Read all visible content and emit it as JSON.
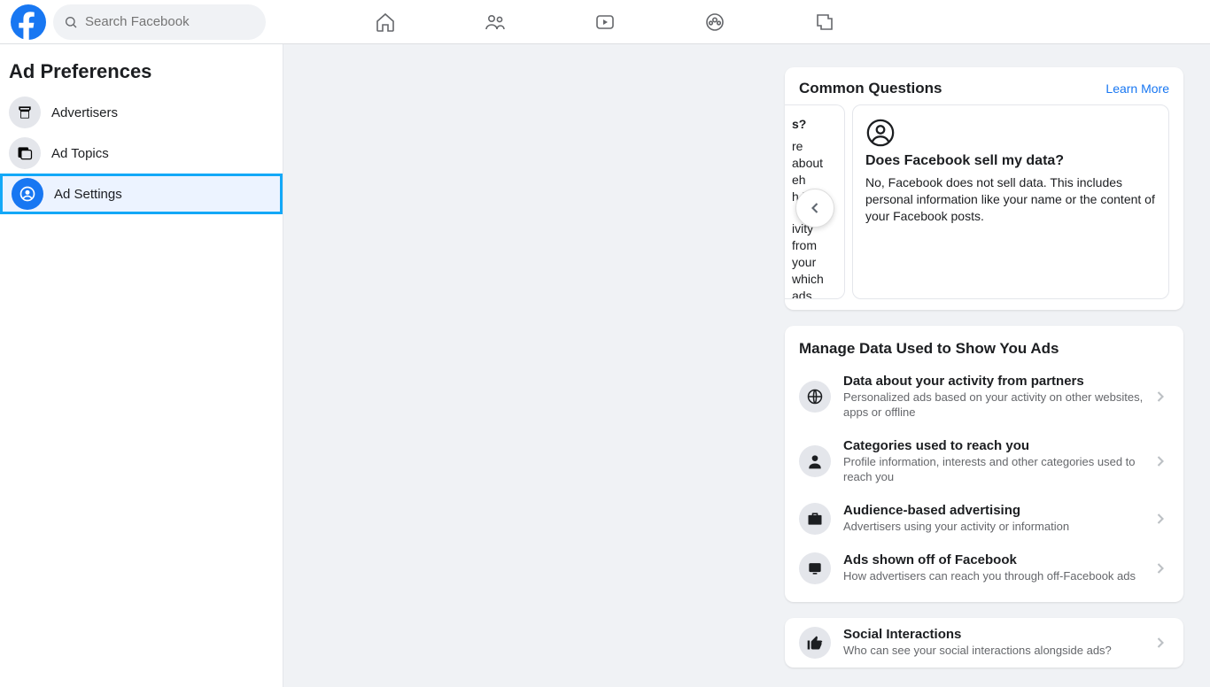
{
  "search": {
    "placeholder": "Search Facebook"
  },
  "sidebar": {
    "title": "Ad Preferences",
    "items": [
      {
        "label": "Advertisers"
      },
      {
        "label": "Ad Topics"
      },
      {
        "label": "Ad Settings"
      }
    ]
  },
  "commonQuestions": {
    "title": "Common Questions",
    "learnMore": "Learn More",
    "partial": {
      "titleFrag": "s?",
      "line1": "re about",
      "line2": "eh",
      "line3": "h    l",
      "line4": "ivity from",
      "line5": "your",
      "line6": "which ads"
    },
    "question": {
      "title": "Does Facebook sell my data?",
      "body": "No, Facebook does not sell data. This includes personal information like your name or the content of your Facebook posts."
    }
  },
  "manageData": {
    "title": "Manage Data Used to Show You Ads",
    "rows": [
      {
        "title": "Data about your activity from partners",
        "sub": "Personalized ads based on your activity on other websites, apps or offline"
      },
      {
        "title": "Categories used to reach you",
        "sub": "Profile information, interests and other categories used to reach you"
      },
      {
        "title": "Audience-based advertising",
        "sub": "Advertisers using your activity or information"
      },
      {
        "title": "Ads shown off of Facebook",
        "sub": "How advertisers can reach you through off-Facebook ads"
      }
    ]
  },
  "social": {
    "title": "Social Interactions",
    "sub": "Who can see your social interactions alongside ads?"
  }
}
